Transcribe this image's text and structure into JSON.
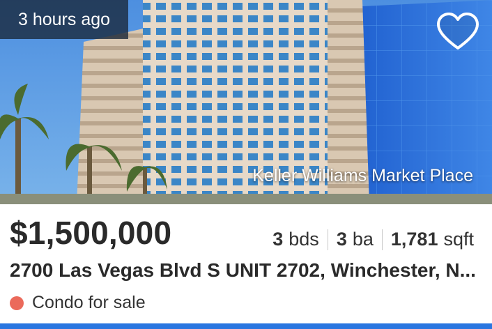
{
  "listing": {
    "time_ago": "3 hours ago",
    "broker": "Keller Williams Market Place",
    "price": "$1,500,000",
    "beds": {
      "value": "3",
      "unit": "bds"
    },
    "baths": {
      "value": "3",
      "unit": "ba"
    },
    "sqft": {
      "value": "1,781",
      "unit": "sqft"
    },
    "address": "2700 Las Vegas Blvd S UNIT 2702, Winchester, N...",
    "status": "Condo for sale"
  },
  "colors": {
    "status_dot": "#eb6a5b",
    "bottom_bar": "#2a76e0",
    "price_text": "#2a2a2a"
  },
  "icons": {
    "favorite": "heart-outline-icon"
  }
}
